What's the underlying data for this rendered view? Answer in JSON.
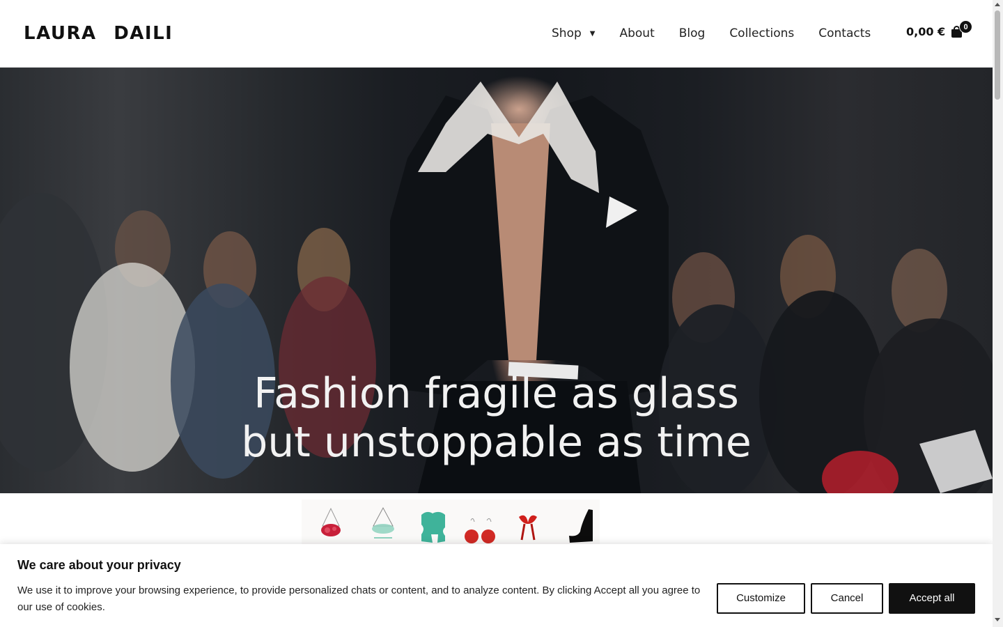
{
  "header": {
    "logo": "LAURA DAILI",
    "nav": [
      {
        "label": "Shop",
        "has_dropdown": true
      },
      {
        "label": "About"
      },
      {
        "label": "Blog"
      },
      {
        "label": "Collections"
      },
      {
        "label": "Contacts"
      }
    ],
    "cart": {
      "total": "0,00 €",
      "count": "0",
      "icon": "shopping-bag-icon"
    }
  },
  "hero": {
    "line1": "Fashion fragile as glass",
    "line2": "but unstoppable as time"
  },
  "products_strip": {
    "items": [
      {
        "name": "red-glass-pendant"
      },
      {
        "name": "green-glass-pendant"
      },
      {
        "name": "green-glass-sculpture"
      },
      {
        "name": "red-ball-earrings"
      },
      {
        "name": "red-bow-earring"
      },
      {
        "name": "black-glass-piece"
      }
    ]
  },
  "cookie_banner": {
    "title": "We care about your privacy",
    "text": "We use it to improve your browsing experience, to provide personalized chats or content, and to analyze content. By clicking Accept all you agree to our use of cookies.",
    "buttons": {
      "customize": "Customize",
      "cancel": "Cancel",
      "accept": "Accept all"
    }
  },
  "colors": {
    "accent": "#111111",
    "background": "#ffffff",
    "hero_text": "#f2f2f2"
  }
}
